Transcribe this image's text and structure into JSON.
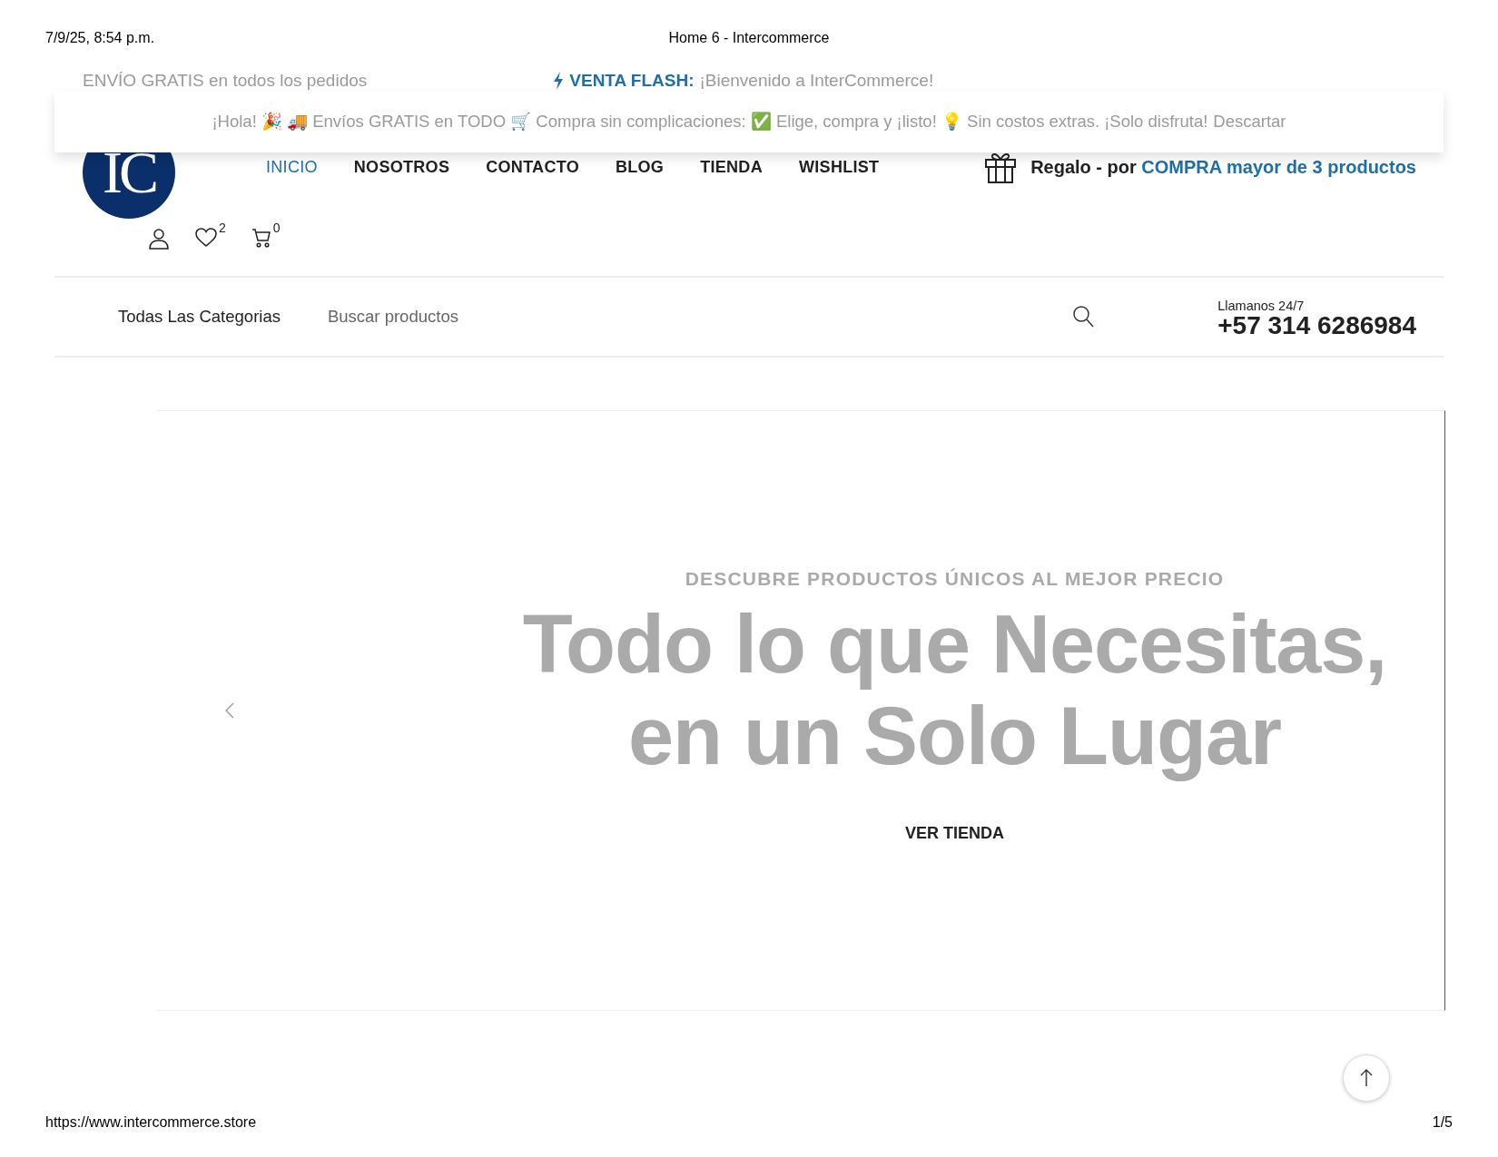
{
  "print_header": {
    "date": "7/9/25, 8:54 p.m.",
    "title": "Home 6 - Intercommerce"
  },
  "top_bar": {
    "left": "ENVÍO GRATIS en todos los pedidos",
    "flash_label": "VENTA FLASH:",
    "flash_text": "¡Bienvenido a InterCommerce!"
  },
  "notice": {
    "text": "¡Hola! 🎉 🚚 Envíos GRATIS en TODO 🛒 Compra sin complicaciones: ✅ Elige, compra y ¡listo! 💡 Sin costos extras. ¡Solo disfruta!",
    "dismiss": "Descartar"
  },
  "logo": {
    "text": "IC"
  },
  "nav": [
    {
      "label": "INICIO",
      "selected": true
    },
    {
      "label": "NOSOTROS",
      "selected": false
    },
    {
      "label": "CONTACTO",
      "selected": false
    },
    {
      "label": "BLOG",
      "selected": false
    },
    {
      "label": "TIENDA",
      "selected": false
    },
    {
      "label": "WISHLIST",
      "selected": false
    }
  ],
  "promo": {
    "text": "Regalo - por",
    "link": "COMPRA mayor de 3 productos"
  },
  "header_icons": {
    "wishlist_count": "2",
    "cart_count": "0"
  },
  "search": {
    "category": "Todas Las Categorias",
    "placeholder": "Buscar productos"
  },
  "phone": {
    "label": "Llamanos 24/7",
    "number": "+57 314 6286984"
  },
  "hero": {
    "eyebrow": "DESCUBRE PRODUCTOS ÚNICOS AL MEJOR PRECIO",
    "title_lines": [
      "Todo lo que Necesitas,",
      "en un Solo Lugar"
    ],
    "button": "VER TIENDA"
  },
  "print_footer": {
    "url": "https://www.intercommerce.store",
    "page": "1/5"
  }
}
